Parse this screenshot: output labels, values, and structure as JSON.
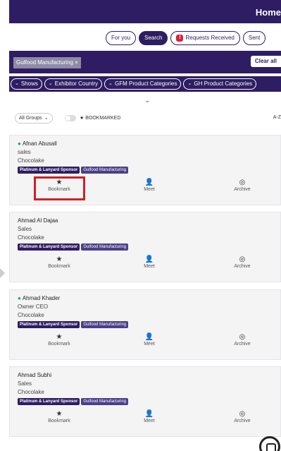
{
  "header": {
    "title": "Home"
  },
  "tabs": [
    {
      "label": "For you",
      "active": false
    },
    {
      "label": "Search",
      "active": true
    },
    {
      "label": "Requests Received",
      "active": false,
      "badge": "!"
    },
    {
      "label": "Sent",
      "active": false
    }
  ],
  "filter": {
    "chip": "Gulfood Manufacturing ×",
    "clear": "Clear all"
  },
  "facets": [
    "Shows",
    "Exhibitor Country",
    "GFM Product Categories",
    "GH Product Categories"
  ],
  "controls": {
    "groups": "All Groups",
    "bookmarked": "★ BOOKMARKED",
    "sort": "A-Z"
  },
  "actions": {
    "bookmark": "Bookmark",
    "meet": "Meet",
    "archive": "Archive"
  },
  "cards": [
    {
      "name": "Afnan Abusall",
      "online": true,
      "role": "sales",
      "company": "Chocolake",
      "tags": [
        "Platinum & Lanyard Sponsor",
        "Gulfood Manufacturing"
      ]
    },
    {
      "name": "Ahmad Al Dajaa",
      "online": false,
      "role": "Sales",
      "company": "Chocolake",
      "tags": [
        "Platinum & Lanyard Sponsor",
        "Gulfood Manufacturing"
      ]
    },
    {
      "name": "Ahmad Khader",
      "online": true,
      "role": "Owner CEO",
      "company": "Chocolake",
      "tags": [
        "Platinum & Lanyard Sponsor",
        "Gulfood Manufacturing"
      ]
    },
    {
      "name": "Ahmad Subhi",
      "online": false,
      "role": "Sales",
      "company": "Chocolake",
      "tags": [
        "Platinum & Lanyard Sponsor",
        "Gulfood Manufacturing"
      ]
    }
  ],
  "colors": {
    "brand": "#2e1d63",
    "highlight": "#d01f26"
  }
}
